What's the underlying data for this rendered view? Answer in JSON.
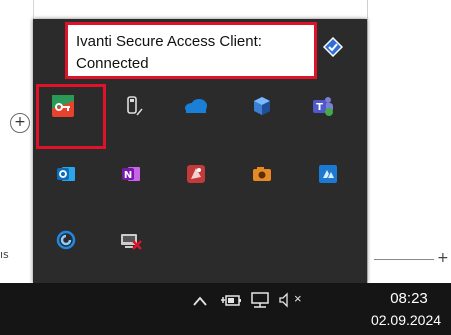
{
  "tooltip": {
    "line1": "Ivanti Secure Access Client:",
    "line2": "Connected"
  },
  "background": {
    "zoom_symbol": "+",
    "left_label": "ıs",
    "right_symbol": "+"
  },
  "tray": {
    "icons": [
      {
        "name": "shield-check-icon",
        "color": "#2f6fd6"
      },
      {
        "name": "ivanti-secure-access-icon",
        "color": "#e8412c"
      },
      {
        "name": "usb-drive-icon",
        "color": "#dddddd"
      },
      {
        "name": "onedrive-cloud-icon",
        "color": "#1a7fd6"
      },
      {
        "name": "cube-3d-icon",
        "color": "#3b7fd2"
      },
      {
        "name": "teams-icon",
        "color": "#6264a7"
      },
      {
        "name": "outlook-icon",
        "color": "#0f6cbd"
      },
      {
        "name": "onenote-icon",
        "color": "#7719aa"
      },
      {
        "name": "graphics-app-icon",
        "color": "#c43a3a"
      },
      {
        "name": "camera-app-icon",
        "color": "#e88a24"
      },
      {
        "name": "azure-app-icon",
        "color": "#1b79d2"
      },
      {
        "name": "swirl-app-icon",
        "color": "#1e88e5"
      },
      {
        "name": "network-error-icon",
        "color": "#cccccc"
      }
    ]
  },
  "taskbar": {
    "chevron_symbol": "^",
    "mute_symbol": "×",
    "time": "08:23",
    "date": "02.09.2024"
  },
  "colors": {
    "highlight": "#e0122a",
    "flyout_bg": "#2b2b2b",
    "taskbar_bg": "#151515"
  }
}
